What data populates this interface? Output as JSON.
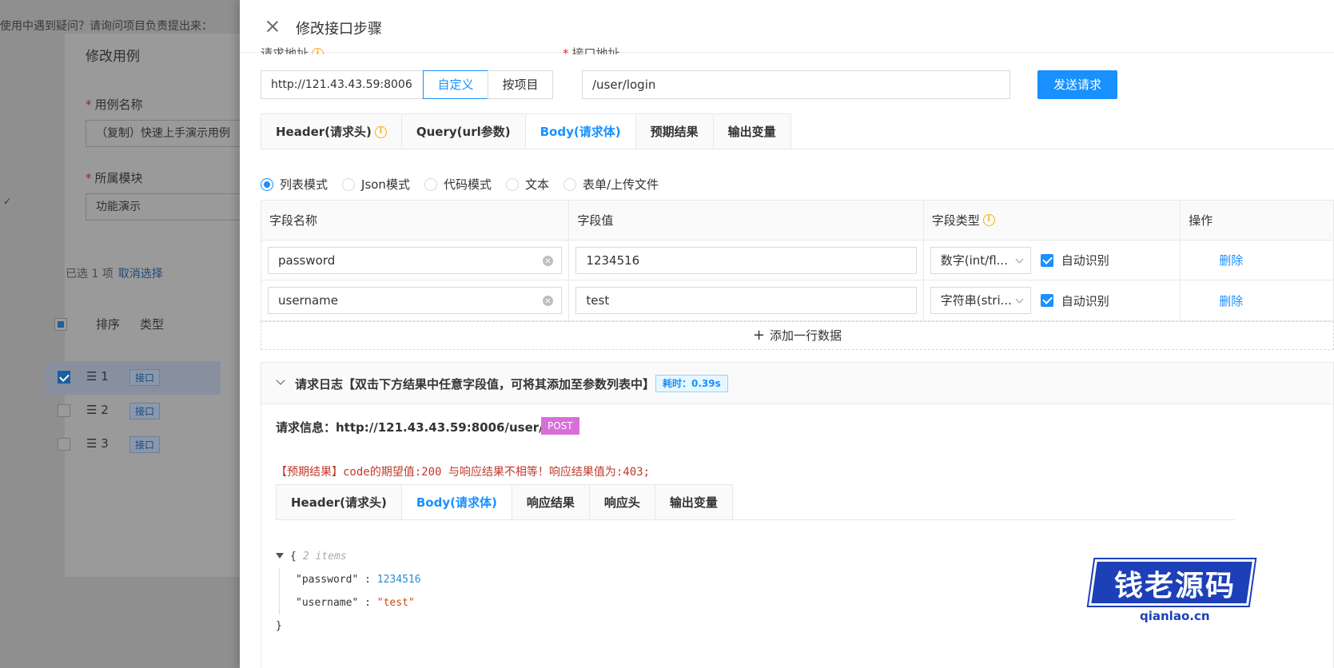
{
  "background": {
    "notice": "使用中遇到疑问？请询问项目负责提出来：",
    "dialog_title": "修改用例",
    "case_name_label": "用例名称",
    "case_name_value": "（复制）快速上手演示用例",
    "module_label": "所属模块",
    "module_value": "功能演示",
    "selected_text": "已选 1 项",
    "cancel_select": "取消选择",
    "table_headers": [
      "排序",
      "类型"
    ],
    "rows": [
      {
        "order": "☰ 1",
        "tag": "接口",
        "checked": true
      },
      {
        "order": "☰ 2",
        "tag": "接口",
        "checked": false
      },
      {
        "order": "☰ 3",
        "tag": "接口",
        "checked": false
      }
    ]
  },
  "drawer": {
    "title": "修改接口步骤",
    "request_addr_label": "请求地址",
    "api_addr_label": "接口地址",
    "base_url": "http://121.43.43.59:8006",
    "custom_btn": "自定义",
    "project_btn": "按项目",
    "path": "/user/login",
    "send_btn": "发送请求"
  },
  "request_tabs": [
    {
      "label": "Header(请求头)",
      "active": false
    },
    {
      "label": "Query(url参数)",
      "active": false
    },
    {
      "label": "Body(请求体)",
      "active": true
    },
    {
      "label": "预期结果",
      "active": false
    },
    {
      "label": "输出变量",
      "active": false
    }
  ],
  "body_modes": [
    {
      "label": "列表模式",
      "checked": true
    },
    {
      "label": "Json模式",
      "checked": false
    },
    {
      "label": "代码模式",
      "checked": false
    },
    {
      "label": "文本",
      "checked": false
    },
    {
      "label": "表单/上传文件",
      "checked": false
    }
  ],
  "params_table": {
    "headers": [
      "字段名称",
      "字段值",
      "字段类型",
      "操作"
    ],
    "rows": [
      {
        "name": "password",
        "value": "1234516",
        "type": "数字(int/fl...",
        "auto": "自动识别",
        "action": "删除"
      },
      {
        "name": "username",
        "value": "test",
        "type": "字符串(stri...",
        "auto": "自动识别",
        "action": "删除"
      }
    ],
    "add_row": "添加一行数据"
  },
  "log": {
    "title": "请求日志【双击下方结果中任意字段值，可将其添加至参数列表中】",
    "time_tag": "耗时：0.39s",
    "req_info": "请求信息：http://121.43.43.59:8006/user/login",
    "method": "POST",
    "expect_msg": "【预期结果】code的期望值:200 与响应结果不相等！响应结果值为:403;",
    "tabs": [
      {
        "label": "Header(请求头)",
        "active": false
      },
      {
        "label": "Body(请求体)",
        "active": true
      },
      {
        "label": "响应结果",
        "active": false
      },
      {
        "label": "响应头",
        "active": false
      },
      {
        "label": "输出变量",
        "active": false
      }
    ],
    "json": {
      "open": "{",
      "items_note": "2 items",
      "lines": [
        {
          "key": "\"password\"",
          "sep": " : ",
          "value": "1234516",
          "kind": "num"
        },
        {
          "key": "\"username\"",
          "sep": " : ",
          "value": "\"test\"",
          "kind": "str"
        }
      ],
      "close": "}"
    }
  },
  "watermark": {
    "text": "钱老源码",
    "sub": "qianlao.cn"
  },
  "colors": {
    "primary": "#1890ff",
    "error": "#c0392b",
    "warning": "#faad14",
    "method_post": "#d86fd8"
  }
}
